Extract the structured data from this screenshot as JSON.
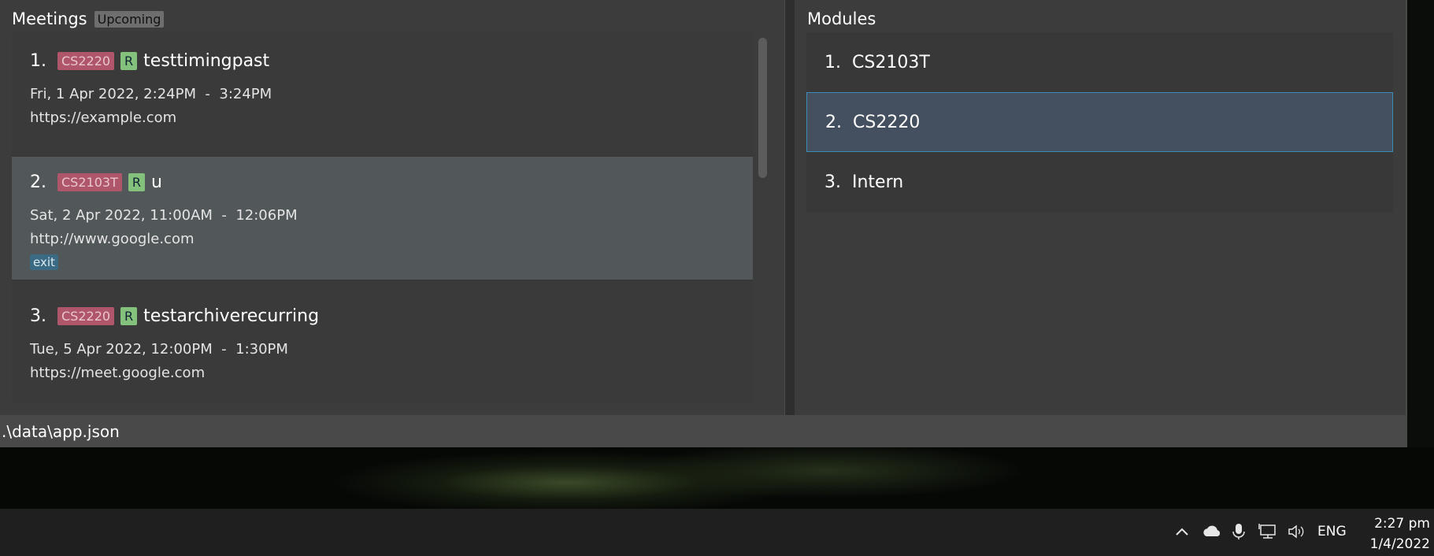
{
  "meetings_panel": {
    "title": "Meetings",
    "filter_badge": "Upcoming",
    "items": [
      {
        "index": "1.",
        "module": "CS2220",
        "recurring": "R",
        "name": "testtimingpast",
        "time": "Fri, 1 Apr 2022, 2:24PM  -  3:24PM",
        "url": "https://example.com",
        "tag": ""
      },
      {
        "index": "2.",
        "module": "CS2103T",
        "recurring": "R",
        "name": "u",
        "time": "Sat, 2 Apr 2022, 11:00AM  -  12:06PM",
        "url": "http://www.google.com",
        "tag": "exit"
      },
      {
        "index": "3.",
        "module": "CS2220",
        "recurring": "R",
        "name": "testarchiverecurring",
        "time": "Tue, 5 Apr 2022, 12:00PM  -  1:30PM",
        "url": "https://meet.google.com",
        "tag": ""
      }
    ]
  },
  "modules_panel": {
    "title": "Modules",
    "items": [
      {
        "index": "1.",
        "code": "CS2103T"
      },
      {
        "index": "2.",
        "code": "CS2220"
      },
      {
        "index": "3.",
        "code": "Intern"
      }
    ]
  },
  "status_bar": {
    "path": ".\\data\\app.json"
  },
  "taskbar": {
    "language": "ENG",
    "time": "2:27 pm",
    "date": "1/4/2022",
    "tray_icons": [
      "chevron-up-icon",
      "cloud-icon",
      "microphone-icon",
      "network-icon",
      "speaker-icon"
    ]
  },
  "colors": {
    "module_tag": "#b0566a",
    "recurring_tag": "#83c17c",
    "exit_tag": "#3b6b84",
    "selected_module": "#44505f",
    "selected_border": "#3d8cb3"
  }
}
